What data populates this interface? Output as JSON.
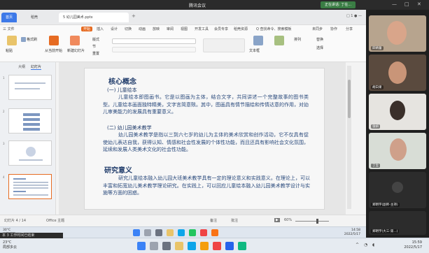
{
  "meeting": {
    "title": "腾讯会议",
    "share_status": "正在讲话: 丁在...",
    "window_controls": [
      "—",
      "□",
      "✕"
    ]
  },
  "app": {
    "tabs": {
      "home": "首页",
      "wps": "稻壳",
      "document": "5 幼儿园美术.pptx"
    },
    "tab_add": "+",
    "tabbar_right": "□ 1 ● —",
    "ribbon_tabs": [
      "三 文件",
      "开始",
      "插入",
      "设计",
      "切换",
      "动画",
      "放映",
      "审阅",
      "视图",
      "开发工具",
      "会员专享",
      "稻壳资源"
    ],
    "ribbon_active_index": 1,
    "ribbon_right": [
      "Q 查找命令、搜索模板",
      "未同步",
      "协作",
      "分享"
    ],
    "toolbar": {
      "format_painter": "格式刷",
      "paste": "粘贴",
      "new_slide": "新建幻灯片",
      "layout": "版式",
      "section": "节",
      "reset": "重置",
      "play_from_current": "从当前开始",
      "text_box": "文本框",
      "arrange": "排列",
      "replace": "替换",
      "select": "选择"
    },
    "left_pane": {
      "tab_outline": "大纲",
      "tab_slides": "幻灯片",
      "slide_numbers": [
        "1",
        "2",
        "3",
        "4"
      ]
    },
    "slide": {
      "h1_core": "核心概念",
      "h2_picture_book": "(一) 儿童绘本",
      "p1": "儿童绘本即图画书。它是以图画为主体，结合文字，共同讲述一个完整故事的图书类型。儿童绘本画面独特精美，文字言简意赅。其中，图画具有情节描绘和传情达意的作用，对幼儿审美能力的发展具有重要意义。",
      "h2_art_teaching": "(二) 幼儿园美术教学",
      "p2": "幼儿园美术教学是指以三到六七岁的幼儿为主体的美术欣赏和创作活动，它不仅具有促使幼儿表达自我，获得认知、情感和社会性发展的个体性功能，而且还具有影响社会文化氛围，延续和发展人类美术文化的社会性功能。",
      "h1_significance": "研究意义",
      "p3": "研究儿童绘本融入幼儿园大班美术教学具有一定的理论意义和实践意义。在理论上，可以丰富和拓宽幼儿美术教学理论研究。在实践上，可以回应儿童绘本融入幼儿园美术教学设计与实施等方面的困惑。"
    },
    "status": {
      "slide_counter": "幻灯片 4 / 14",
      "theme": "Office 主题",
      "notes": "备注",
      "comments": "批注",
      "zoom": "60%"
    }
  },
  "inner_taskbar": {
    "weather_temp": "30°C",
    "weather_desc": "局部晴朗",
    "time": "14:58",
    "date": "2022/5/17"
  },
  "participants": [
    {
      "name": "邱婧蕾"
    },
    {
      "name": "胡白果"
    },
    {
      "name": "张妍"
    },
    {
      "name": "丁宝"
    },
    {
      "name": "郑明宇(副师-主持)"
    },
    {
      "name": "郑明宇(大三-第...)"
    }
  ],
  "outer_taskbar": {
    "notice": "本 3 工作时间已结束",
    "weather_temp": "23°C",
    "weather_desc": "局部多云",
    "time": "15:59",
    "date": "2022/5/17"
  },
  "colors": {
    "accent_blue": "#3d79e8",
    "ribbon_orange": "#e66b22",
    "slide_heading": "#1f3b6a",
    "slide_text": "#2a4a7c"
  }
}
